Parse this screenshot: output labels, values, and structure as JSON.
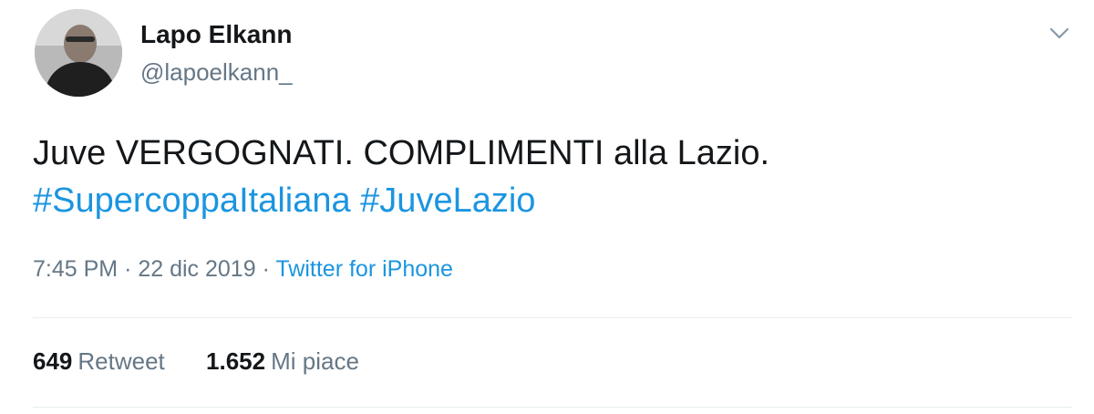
{
  "user": {
    "display_name": "Lapo Elkann",
    "handle": "@lapoelkann_"
  },
  "tweet": {
    "text": "Juve VERGOGNATI. COMPLIMENTI alla Lazio.",
    "hashtags": [
      "#SupercoppaItaliana",
      "#JuveLazio"
    ]
  },
  "meta": {
    "time": "7:45 PM",
    "separator": "·",
    "date": "22 dic 2019",
    "source": "Twitter for iPhone"
  },
  "stats": {
    "retweets_count": "649",
    "retweets_label": "Retweet",
    "likes_count": "1.652",
    "likes_label": "Mi piace"
  },
  "icons": {
    "menu": "chevron-down-icon",
    "avatar": "avatar"
  },
  "colors": {
    "link": "#1b95e0",
    "secondary_text": "#657786",
    "primary_text": "#14171a",
    "divider": "#e6ecf0"
  }
}
